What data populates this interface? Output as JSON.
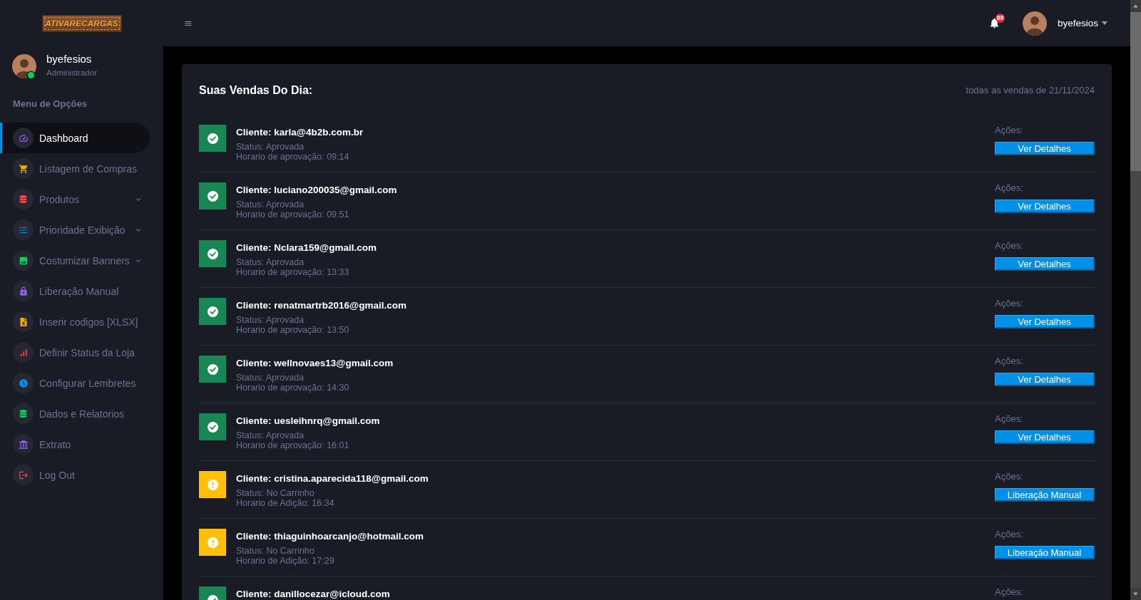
{
  "sidebar": {
    "logo": "ATIVARECARGAS",
    "profile": {
      "name": "byefesios",
      "role": "Administrador",
      "online": true
    },
    "menu_title": "Menu de Opções",
    "items": [
      {
        "label": "Dashboard",
        "selected": true
      },
      {
        "label": "Listagem de Compras",
        "selected": false
      },
      {
        "label": "Produtos",
        "selected": false,
        "expanded": false
      },
      {
        "label": "Prioridade Exibição",
        "selected": false,
        "expanded": false
      },
      {
        "label": "Costumizar Banners",
        "selected": false,
        "expanded": false
      },
      {
        "label": "Liberação Manual",
        "selected": false
      },
      {
        "label": "Inserir codigos [XLSX]",
        "selected": false
      },
      {
        "label": "Definir Status da Loja",
        "selected": false
      },
      {
        "label": "Configurar Lembretes",
        "selected": false
      },
      {
        "label": "Dados e Relatorios",
        "selected": false
      },
      {
        "label": "Extrato",
        "selected": false
      },
      {
        "label": "Log Out",
        "selected": false
      }
    ]
  },
  "topbar": {
    "notifications_badge": "88",
    "user_name": "byefesios"
  },
  "sales_card": {
    "title": "Suas Vendas Do Dia:",
    "subtitle": "todas as vendas de 21/11/2024",
    "rows": [
      {
        "kind": "approved",
        "client": "Cliente: karla@4b2b.com.br",
        "status": "Status: Aprovada",
        "time": "Horario de aprovação: 09:14",
        "actions_label": "Ações:",
        "button": "Ver Detalhes"
      },
      {
        "kind": "approved",
        "client": "Cliente: luciano200035@gmail.com",
        "status": "Status: Aprovada",
        "time": "Horario de aprovação: 09:51",
        "actions_label": "Ações:",
        "button": "Ver Detalhes"
      },
      {
        "kind": "approved",
        "client": "Cliente: Nclara159@gmail.com",
        "status": "Status: Aprovada",
        "time": "Horario de aprovação: 13:33",
        "actions_label": "Ações:",
        "button": "Ver Detalhes"
      },
      {
        "kind": "approved",
        "client": "Cliente: renatmartrb2016@gmail.com",
        "status": "Status: Aprovada",
        "time": "Horario de aprovação: 13:50",
        "actions_label": "Ações:",
        "button": "Ver Detalhes"
      },
      {
        "kind": "approved",
        "client": "Cliente: wellnovaes13@gmail.com",
        "status": "Status: Aprovada",
        "time": "Horario de aprovação: 14:30",
        "actions_label": "Ações:",
        "button": "Ver Detalhes"
      },
      {
        "kind": "approved",
        "client": "Cliente: uesleihnrq@gmail.com",
        "status": "Status: Aprovada",
        "time": "Horario de aprovação: 16:01",
        "actions_label": "Ações:",
        "button": "Ver Detalhes"
      },
      {
        "kind": "cart",
        "client": "Cliente: cristina.aparecida118@gmail.com",
        "status": "Status: No Carrinho",
        "time": "Horario de Adição: 16:34",
        "actions_label": "Ações:",
        "button": "Liberação Manual"
      },
      {
        "kind": "cart",
        "client": "Cliente: thiaguinhoarcanjo@hotmail.com",
        "status": "Status: No Carrinho",
        "time": "Horario de Adição: 17:29",
        "actions_label": "Ações:",
        "button": "Liberação Manual"
      },
      {
        "kind": "approved",
        "client": "Cliente: danillocezar@icloud.com",
        "actions_label": "Ações:"
      }
    ]
  }
}
